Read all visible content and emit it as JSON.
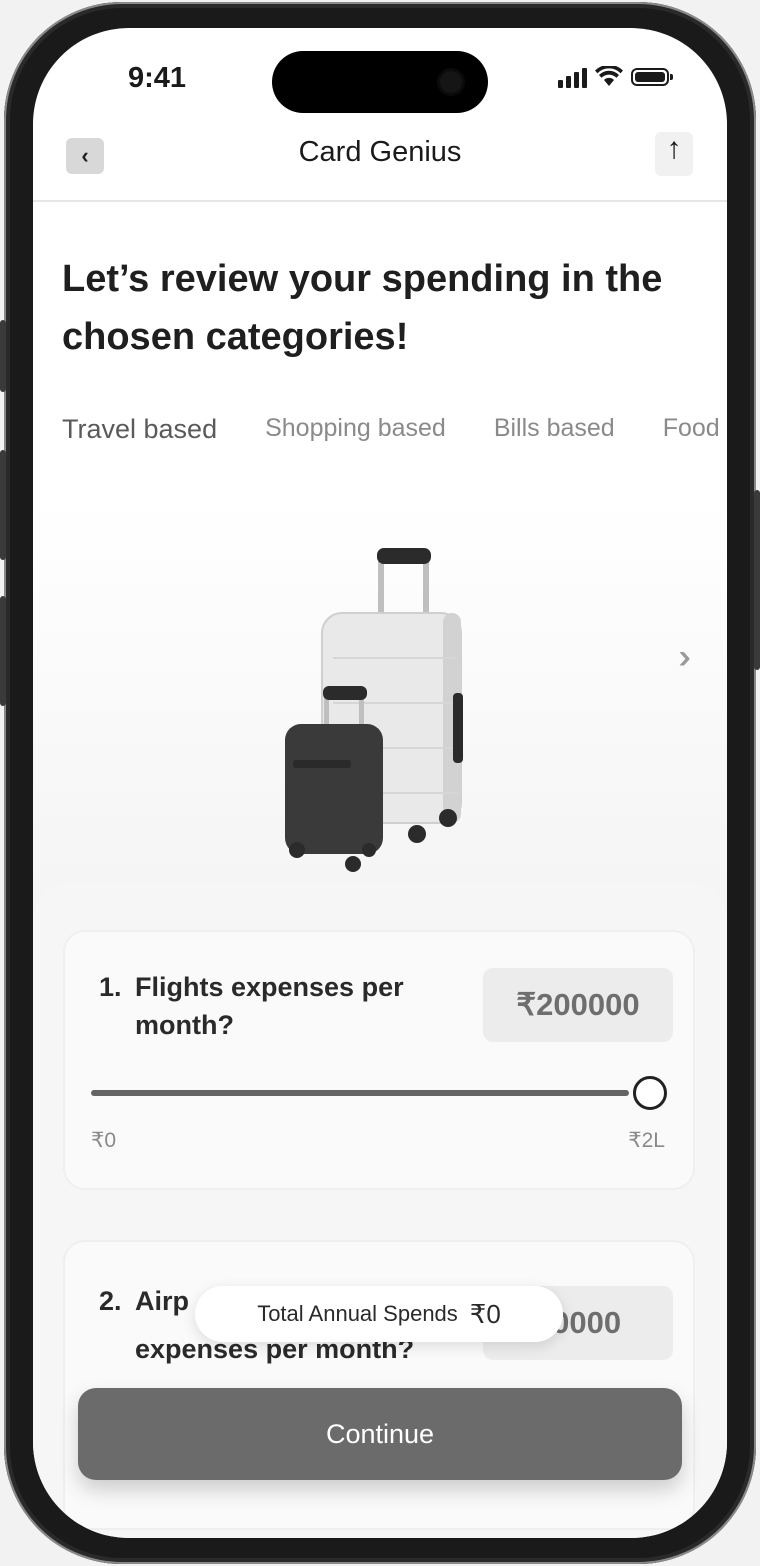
{
  "status_bar": {
    "time": "9:41"
  },
  "nav": {
    "title": "Card Genius"
  },
  "headline": "Let’s review your spending in the chosen categories!",
  "tabs": [
    {
      "label": "Travel based",
      "active": true
    },
    {
      "label": "Shopping based",
      "active": false
    },
    {
      "label": "Bills based",
      "active": false
    },
    {
      "label": "Food",
      "active": false
    }
  ],
  "hero": {
    "image": "suitcases-illustration",
    "next_icon": "double-chevron-right-icon"
  },
  "questions": [
    {
      "number": "1.",
      "text": "Flights expenses per month?",
      "amount": "₹200000",
      "slider": {
        "min_label": "₹0",
        "max_label": "₹2L",
        "fraction": 1.0
      }
    },
    {
      "number": "2.",
      "text_visible_top": "Airp",
      "text_visible_bottom": "expenses per month?",
      "amount_visible": "00000"
    }
  ],
  "total": {
    "label": "Total Annual Spends",
    "value": "₹0"
  },
  "continue_label": "Continue"
}
